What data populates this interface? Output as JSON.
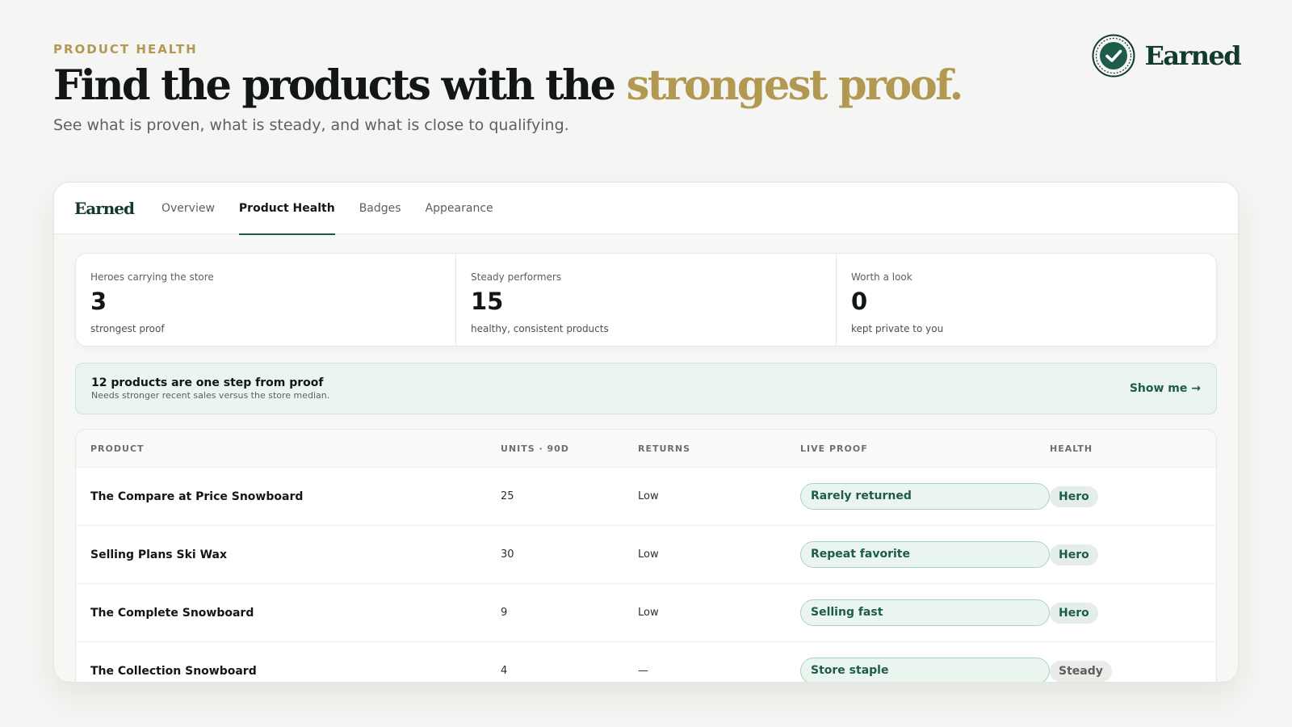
{
  "hero": {
    "eyebrow": "PRODUCT HEALTH",
    "headline_main": "Find the products with the ",
    "headline_accent": "strongest proof.",
    "subline": "See what is proven, what is steady, and what is close to qualifying."
  },
  "brand": {
    "name": "Earned",
    "icon": "check-seal-icon"
  },
  "nav": {
    "brand": "Earned",
    "tabs": [
      {
        "label": "Overview",
        "active": false
      },
      {
        "label": "Product Health",
        "active": true
      },
      {
        "label": "Badges",
        "active": false
      },
      {
        "label": "Appearance",
        "active": false
      }
    ]
  },
  "stats": [
    {
      "label": "Heroes carrying the store",
      "value": "3",
      "note": "strongest proof"
    },
    {
      "label": "Steady performers",
      "value": "15",
      "note": "healthy, consistent products"
    },
    {
      "label": "Worth a look",
      "value": "0",
      "note": "kept private to you"
    }
  ],
  "banner": {
    "title": "12 products are one step from proof",
    "subtitle": "Needs stronger recent sales versus the store median.",
    "action": "Show me →"
  },
  "table": {
    "headers": {
      "product": "PRODUCT",
      "units": "UNITS · 90D",
      "returns": "RETURNS",
      "proof": "LIVE PROOF",
      "health": "HEALTH"
    },
    "rows": [
      {
        "product": "The Compare at Price Snowboard",
        "units": "25",
        "returns": "Low",
        "proof": "Rarely returned",
        "health": "Hero"
      },
      {
        "product": "Selling Plans Ski Wax",
        "units": "30",
        "returns": "Low",
        "proof": "Repeat favorite",
        "health": "Hero"
      },
      {
        "product": "The Complete Snowboard",
        "units": "9",
        "returns": "Low",
        "proof": "Selling fast",
        "health": "Hero"
      },
      {
        "product": "The Collection Snowboard",
        "units": "4",
        "returns": "—",
        "proof": "Store staple",
        "health": "Steady"
      }
    ]
  },
  "colors": {
    "accent_gold": "#b39852",
    "brand_green": "#1d5c4a",
    "banner_bg": "#eaf5f0"
  }
}
